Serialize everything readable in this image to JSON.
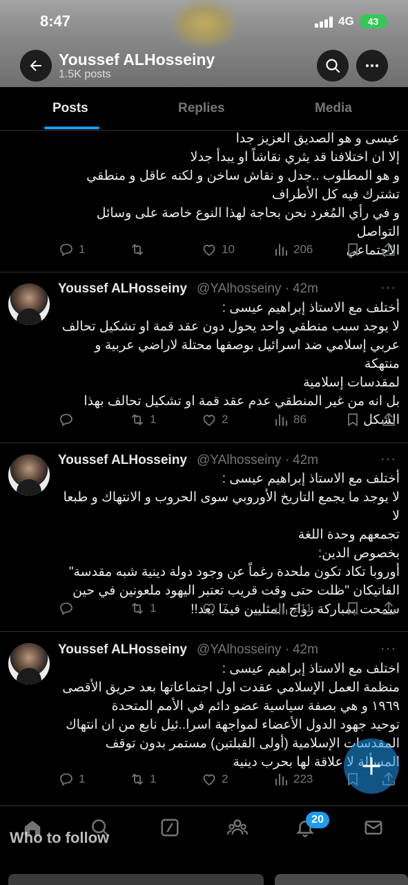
{
  "status_bar": {
    "time": "8:47",
    "network": "4G",
    "battery": "43"
  },
  "header": {
    "title": "Youssef ALHosseiny",
    "subtitle": "1.5K posts"
  },
  "tabs": [
    {
      "label": "Posts",
      "active": true
    },
    {
      "label": "Replies",
      "active": false
    },
    {
      "label": "Media",
      "active": false
    }
  ],
  "posts": [
    {
      "text": "عيسى و هو الصديق العزيز جدا\nإلا ان اختلافنا قد يثري نقاشاً او يبدأ جدلا\nو هو المطلوب ..جدل و نقاش ساخن و لكنه عاقل و منطقي\nتشترك فيه كل الأطراف\nو في رأي المُغرد نحن بحاجة لهذا النوع خاصة على وسائل التواصل\nالاجتماعي",
      "replies": "1",
      "reposts": "",
      "likes": "10",
      "views": "206"
    },
    {
      "name": "Youssef ALHosseiny",
      "handle": "@YAlhosseiny",
      "time": "42m",
      "text": "أختلف مع الاستاذ إبراهيم عيسى :\nلا يوجد سبب منطقي واحد يحول دون عقد قمة او تشكيل تحالف\nعربي إسلامي ضد اسرائيل بوصفها محتلة لاراضي عربية و منتهكة\nلمقدسات إسلامية\nبل انه من غير المنطقي عدم عقد قمة او تشكيل تحالف بهذا\nالشكل",
      "replies": "",
      "reposts": "1",
      "likes": "2",
      "views": "86"
    },
    {
      "name": "Youssef ALHosseiny",
      "handle": "@YAlhosseiny",
      "time": "42m",
      "text": "أختلف مع الاستاذ إبراهيم عيسى :\nلا يوجد ما يجمع التاريخ الأوروبي سوى الحروب و الانتهاك و طبعا لا\nتجمعهم وحدة اللغة\nبخصوص الدين:\nأوروبا تكاد تكون ملحدة رغماً عن وجود دولة دينية شبه مقدسة\"\nالفاتيكان \"ظلت حتى وقت قريب تعتبر اليهود ملعونين في حين\nسمحت بمباركة زواج المثليين فيما بعد!!",
      "replies": "",
      "reposts": "1",
      "likes": "7",
      "views": "211"
    },
    {
      "name": "Youssef ALHosseiny",
      "handle": "@YAlhosseiny",
      "time": "42m",
      "text": "اختلف مع الاستاذ إبراهيم عيسى :\nمنظمة العمل الإسلامي عقدت اول اجتماعاتها بعد حريق الأقصى\n١٩٦٩ و هي بصفة سياسية عضو دائم في الأمم المتحدة\nتوحيد جهود الدول الأعضاء لمواجهة اسرا..ئيل نابع من ان انتهاك\nالمقدسات الإسلامية (أولى القبلتين) مستمر بدون توقف\nالمسألة لا علاقة لها بحرب دينية",
      "replies": "1",
      "reposts": "1",
      "likes": "2",
      "views": "223"
    }
  ],
  "bottom_nav": {
    "notifications_badge": "20",
    "who_to_follow": "Who to follow"
  },
  "colors": {
    "accent": "#1d9bf0",
    "muted": "#71767b",
    "text": "#e7e9ea",
    "background": "#000000"
  }
}
